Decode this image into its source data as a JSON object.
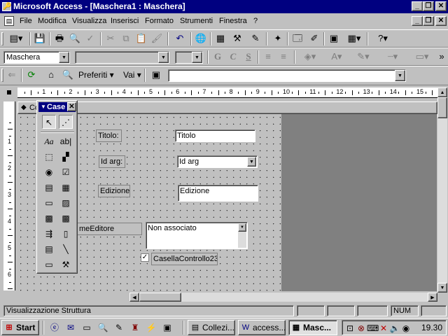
{
  "window": {
    "title": "Microsoft Access - [Maschera1 : Maschera]"
  },
  "menu": [
    "File",
    "Modifica",
    "Visualizza",
    "Inserisci",
    "Formato",
    "Strumenti",
    "Finestra",
    "?"
  ],
  "toolbar2": {
    "object_combo": "Maschera",
    "font_combo": "",
    "size_combo": "",
    "bold": "G",
    "italic": "C",
    "underline": "S"
  },
  "toolbar3": {
    "favorites": "Preferiti",
    "goto": "Vai",
    "address": ""
  },
  "ruler": {
    "labels": [
      "1",
      "2",
      "3",
      "4",
      "5",
      "6",
      "7",
      "8",
      "9",
      "10",
      "11",
      "12",
      "13",
      "14",
      "15"
    ],
    "vlabels": [
      "1",
      "2",
      "3",
      "4",
      "5",
      "6"
    ]
  },
  "section": {
    "header_label": "Co"
  },
  "toolbox": {
    "title": "Case",
    "label_tool": "Aa",
    "textbox_tool": "ab|"
  },
  "form": {
    "titolo_label": "Titolo:",
    "titolo_field": "Titolo",
    "idarg_label": "Id arg:",
    "idarg_field": "Id arg",
    "edizione_label": "Edizione",
    "edizione_field": "Edizione",
    "editore_label": "meEditore",
    "editore_field": "Non associato",
    "checkbox_label": "CasellaControllo23"
  },
  "status": {
    "text": "Visualizzazione Struttura",
    "num": "NUM"
  },
  "taskbar": {
    "start": "Start",
    "tasks": [
      "Collezi...",
      "access...",
      "Masc..."
    ],
    "clock": "19.30"
  }
}
